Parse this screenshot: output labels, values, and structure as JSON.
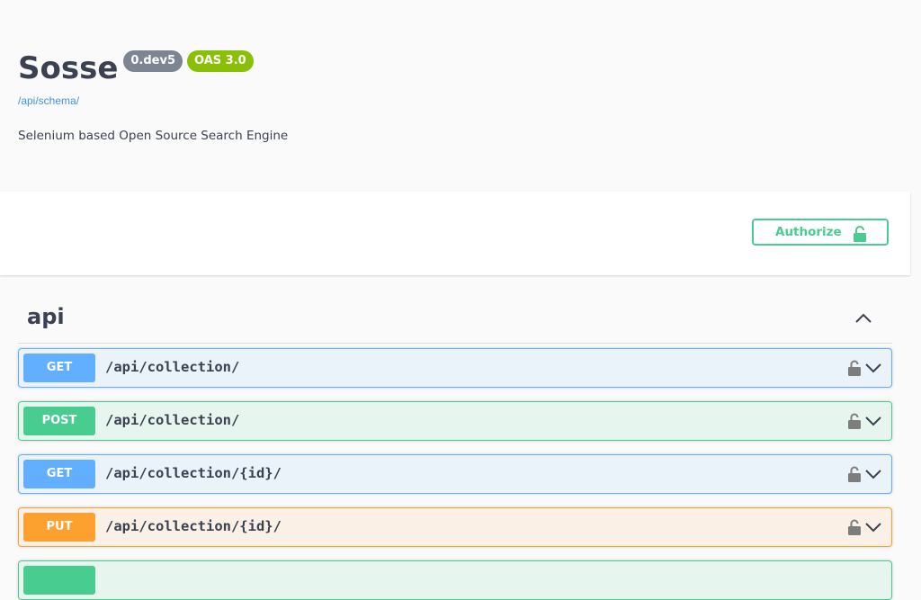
{
  "info": {
    "title": "Sosse",
    "version_badge": "0.dev5",
    "oas_badge": "OAS 3.0",
    "schema_link": "/api/schema/",
    "description": "Selenium based Open Source Search Engine"
  },
  "auth": {
    "authorize_label": "Authorize"
  },
  "tag": {
    "name": "api"
  },
  "operations": [
    {
      "method": "GET",
      "path": "/api/collection/"
    },
    {
      "method": "POST",
      "path": "/api/collection/"
    },
    {
      "method": "GET",
      "path": "/api/collection/{id}/"
    },
    {
      "method": "PUT",
      "path": "/api/collection/{id}/"
    },
    {
      "method": "",
      "path": ""
    }
  ],
  "colors": {
    "get": "#61affe",
    "post": "#49cc90",
    "put": "#fca130",
    "version_badge": "#7d8492",
    "oas_badge": "#89bf04",
    "link": "#4990e2"
  },
  "icons": {
    "authorize": "unlock-icon",
    "operation_lock": "unlock-icon",
    "operation_expand": "chevron-down-icon",
    "tag_collapse": "chevron-up-icon"
  }
}
